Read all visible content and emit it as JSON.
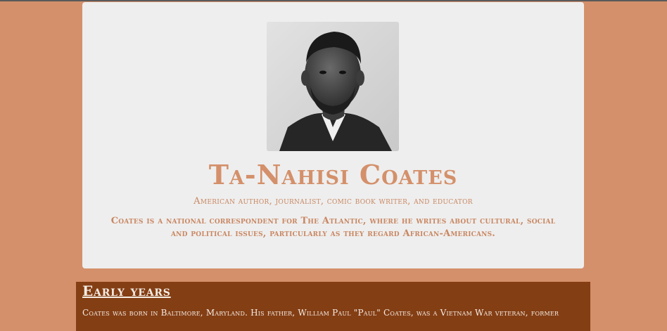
{
  "profile": {
    "name": "Ta-Nahisi Coates",
    "tagline": "American author, journalist, comic book writer, and educator",
    "summary": "Coates is a national correspondent for The Atlantic, where he writes about cultural, social and political issues, particularly as they regard African-Americans.",
    "portrait_alt": "portrait-photo"
  },
  "sections": [
    {
      "title": "Early years",
      "text": "Coates was born in Baltimore, Maryland. His father, William Paul \"Paul\" Coates, was a Vietnam War veteran, former"
    }
  ],
  "colors": {
    "page_background": "#d4906a",
    "card_background": "#eeeeee",
    "accent_text": "#d4906a",
    "section_background": "#843e14",
    "section_text": "#f5ece4"
  }
}
